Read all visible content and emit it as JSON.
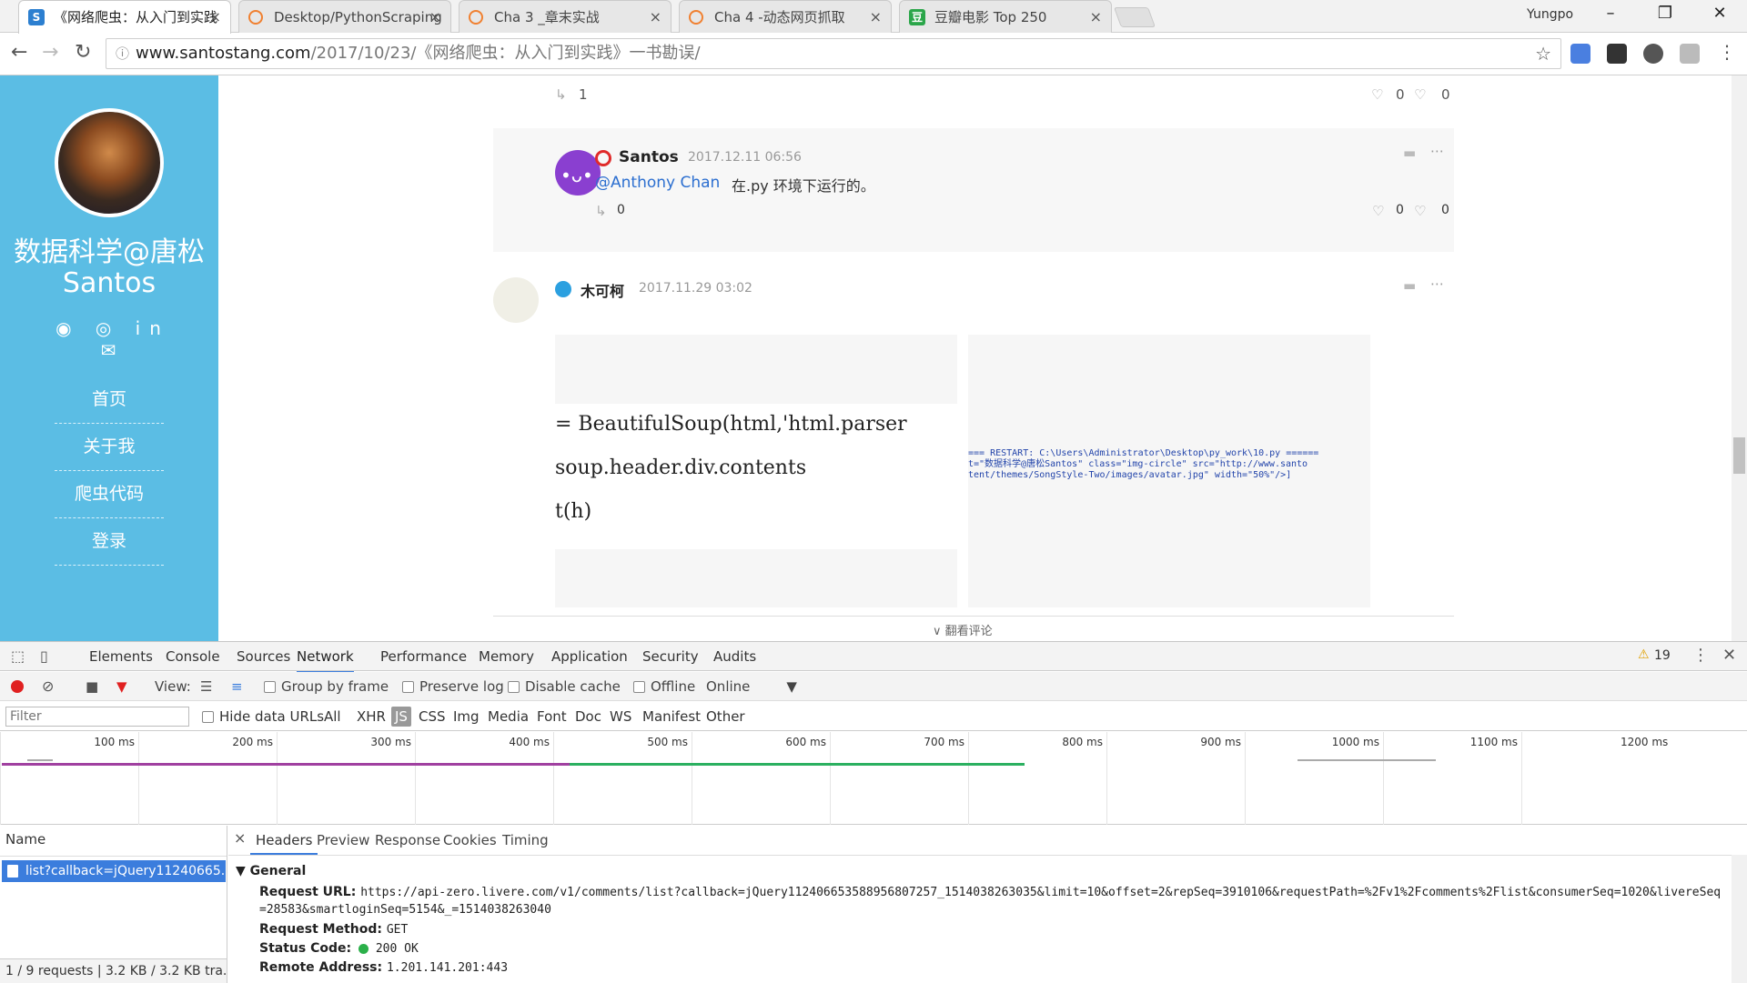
{
  "browser": {
    "tabs": [
      {
        "label": "《网络爬虫：从入门到实践",
        "close": "×",
        "fav": "S",
        "color": "#2c7fd0"
      },
      {
        "label": "Desktop/PythonScraping",
        "close": "×",
        "fav": "",
        "color": "#f08030"
      },
      {
        "label": "Cha 3 _章末实战",
        "close": "×",
        "fav": "",
        "color": "#f08030"
      },
      {
        "label": "Cha 4 -动态网页抓取",
        "close": "×",
        "fav": "",
        "color": "#f08030"
      },
      {
        "label": "豆瓣电影 Top 250",
        "close": "×",
        "fav": "豆",
        "color": "#2ba64a"
      }
    ],
    "user": "Yungpo",
    "window": {
      "minimize": "–",
      "restore": "❐",
      "close": "✕"
    },
    "nav": {
      "back": "←",
      "forward": "→",
      "reload": "↻"
    },
    "url_host": "www.santostang.com",
    "url_path": "/2017/10/23/《网络爬虫：从入门到实践》一书勘误/",
    "star": "☆",
    "menu": "⋮"
  },
  "sidebar": {
    "title_cn": "数据科学@唐松",
    "title_en": "Santos",
    "social": "◉ ◎ in ✉",
    "menu": [
      "首页",
      "关于我",
      "爬虫代码",
      "登录"
    ]
  },
  "comments": {
    "top_reply_count": "1",
    "top_like": "0",
    "top_dislike": "0",
    "reply": {
      "author": "Santos",
      "time": "2017.12.11 06:56",
      "mention": "@Anthony Chan",
      "text": "在.py 环境下运行的。",
      "reply_count": "0",
      "like": "0",
      "dislike": "0"
    },
    "comment2": {
      "author": "木可柯",
      "time": "2017.11.29 03:02"
    },
    "code_lines": [
      " = BeautifulSoup(html,'html.parser",
      "soup.header.div.contents",
      "t(h)"
    ],
    "shot_output": "=== RESTART: C:\\Users\\Administrator\\Desktop\\py_work\\10.py ======\nt=\"数据科学@唐松Santos\" class=\"img-circle\" src=\"http://www.santo\ntent/themes/SongStyle-Two/images/avatar.jpg\" width=\"50%\"/>]",
    "more": "∨ 翻看评论"
  },
  "devtools": {
    "tabs": [
      "Elements",
      "Console",
      "Sources",
      "Network",
      "Performance",
      "Memory",
      "Application",
      "Security",
      "Audits"
    ],
    "active_tab": "Network",
    "warning_count": "19",
    "toolbar": {
      "view": "View:",
      "group_by_frame": "Group by frame",
      "preserve_log": "Preserve log",
      "disable_cache": "Disable cache",
      "offline": "Offline",
      "throttle": "Online"
    },
    "filter_placeholder": "Filter",
    "filters": [
      "Hide data URLs",
      "All",
      "XHR",
      "JS",
      "CSS",
      "Img",
      "Media",
      "Font",
      "Doc",
      "WS",
      "Manifest",
      "Other"
    ],
    "ticks": [
      "100 ms",
      "200 ms",
      "300 ms",
      "400 ms",
      "500 ms",
      "600 ms",
      "700 ms",
      "800 ms",
      "900 ms",
      "1000 ms",
      "1100 ms",
      "1200 ms"
    ],
    "name_header": "Name",
    "request_name": "list?callback=jQuery11240665...",
    "status_bar": "1 / 9 requests  |  3.2 KB / 3.2 KB tra...",
    "detail_tabs": [
      "Headers",
      "Preview",
      "Response",
      "Cookies",
      "Timing"
    ],
    "general": "▼ General",
    "request_url_label": "Request URL:",
    "request_url": "https://api-zero.livere.com/v1/comments/list?callback=jQuery112406653588956807257_1514038263035&limit=10&offset=2&repSeq=3910106&requestPath=%2Fv1%2Fcomments%2Flist&consumerSeq=1020&livereSeq=28583&smartloginSeq=5154&_=1514038263040",
    "method_label": "Request Method:",
    "method": "GET",
    "status_label": "Status Code:",
    "status": "200 OK",
    "remote_label": "Remote Address:",
    "remote": "1.201.141.201:443"
  }
}
